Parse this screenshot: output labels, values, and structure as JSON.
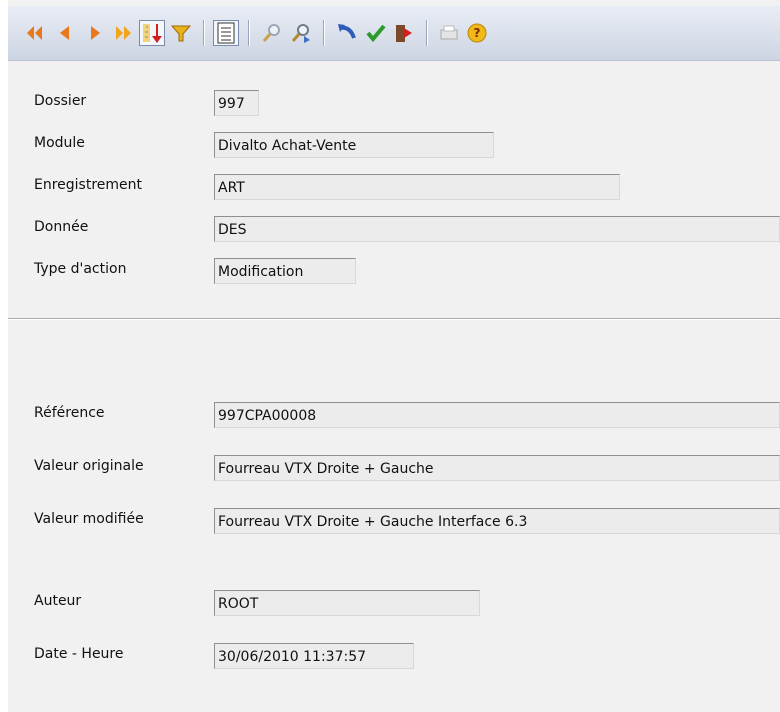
{
  "toolbar": {
    "buttons": [
      {
        "icon": "first-record-icon"
      },
      {
        "icon": "previous-record-icon"
      },
      {
        "icon": "next-record-icon"
      },
      {
        "icon": "last-record-icon"
      },
      {
        "icon": "sort-icon"
      },
      {
        "icon": "filter-icon"
      },
      {
        "icon": "list-view-icon"
      },
      {
        "icon": "search-icon"
      },
      {
        "icon": "search-next-icon"
      },
      {
        "icon": "undo-icon"
      },
      {
        "icon": "validate-icon"
      },
      {
        "icon": "exit-icon"
      },
      {
        "icon": "print-icon"
      },
      {
        "icon": "help-icon"
      }
    ]
  },
  "form": {
    "dossier": {
      "label": "Dossier",
      "value": "997"
    },
    "module": {
      "label": "Module",
      "value": "Divalto Achat-Vente"
    },
    "enregistrement": {
      "label": "Enregistrement",
      "value": "ART"
    },
    "donnee": {
      "label": "Donnée",
      "value": "DES"
    },
    "type_action": {
      "label": "Type d'action",
      "value": "Modification"
    },
    "reference": {
      "label": "Référence",
      "value": "997CPA00008"
    },
    "valeur_originale": {
      "label": "Valeur originale",
      "value": "Fourreau VTX Droite + Gauche"
    },
    "valeur_modifiee": {
      "label": "Valeur modifiée",
      "value": "Fourreau VTX Droite + Gauche Interface 6.3"
    },
    "auteur": {
      "label": "Auteur",
      "value": "ROOT"
    },
    "date_heure": {
      "label": "Date - Heure",
      "value": "30/06/2010 11:37:57"
    }
  }
}
